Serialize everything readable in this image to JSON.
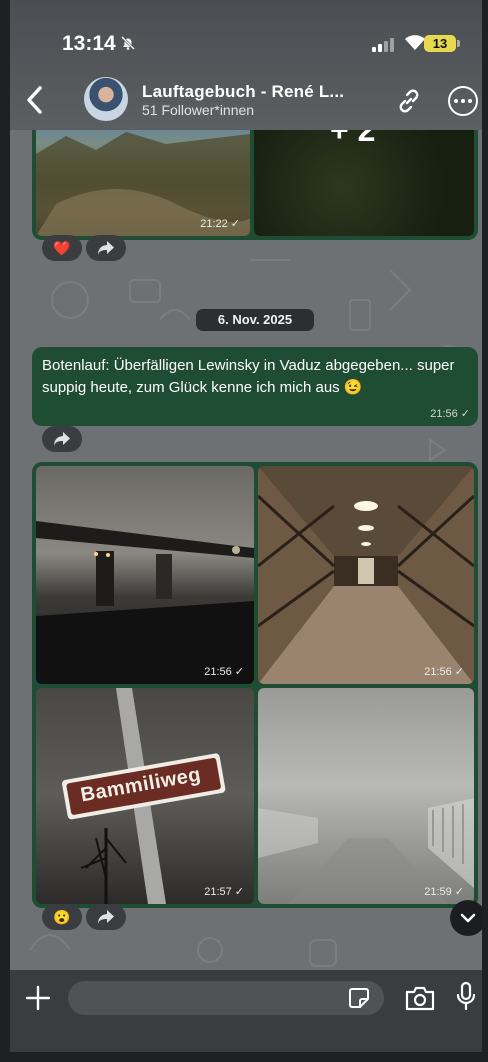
{
  "status": {
    "time": "13:14",
    "battery": "13"
  },
  "header": {
    "title": "Lauftagebuch - René L...",
    "subtitle": "51 Follower*innen"
  },
  "messages": {
    "album1": {
      "overflow_label": "+ 2",
      "timestamp": "21:22",
      "reaction": "❤️"
    },
    "date_separator": "6. Nov. 2025",
    "text_message": {
      "text": "Botenlauf: Überfälligen Lewinsky in Vaduz abgegeben... super suppig heute, zum Glück kenne ich mich aus 😉",
      "timestamp": "21:56"
    },
    "album2": {
      "photos": [
        {
          "timestamp": "21:56",
          "subject": "bridge in fog at night"
        },
        {
          "timestamp": "21:56",
          "subject": "covered wooden bridge interior"
        },
        {
          "timestamp": "21:57",
          "subject": "street sign",
          "sign_text": "Bammiliweg"
        },
        {
          "timestamp": "21:59",
          "subject": "foggy bridge walkway"
        }
      ],
      "reaction": "😮"
    }
  },
  "composer": {
    "placeholder": ""
  },
  "colors": {
    "bubble": "#1f4d33",
    "chat_background": "#6e7174",
    "bars": "#3a3d40"
  }
}
